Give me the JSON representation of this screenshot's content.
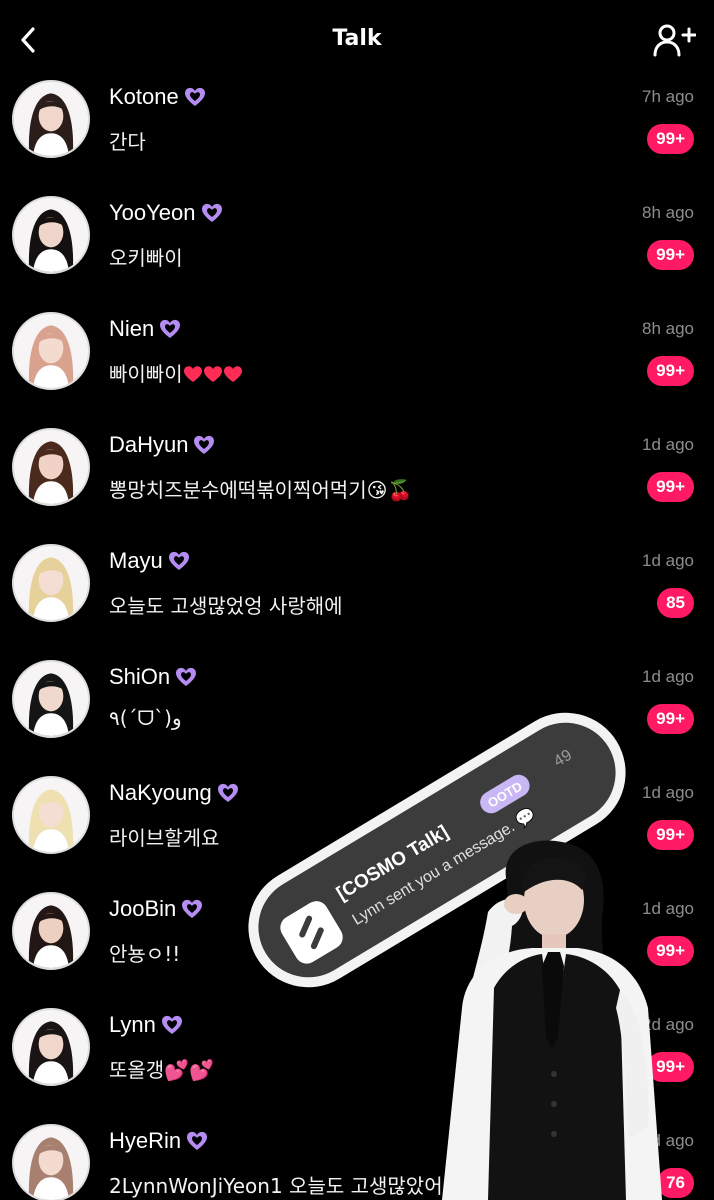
{
  "header": {
    "title": "Talk",
    "back_icon": "chevron-left-icon",
    "add_icon": "add-user-icon"
  },
  "colors": {
    "background": "#000000",
    "badge": "#ff1a63",
    "heart": "#b48cf2",
    "time": "#8d8d8d"
  },
  "chats": [
    {
      "name": "Kotone",
      "time": "7h ago",
      "message": "간다",
      "badge": "99+"
    },
    {
      "name": "YooYeon",
      "time": "8h ago",
      "message": "오키빠이",
      "badge": "99+"
    },
    {
      "name": "Nien",
      "time": "8h ago",
      "message": "빠이빠이",
      "badge": "99+",
      "emoji": "red-heart x3"
    },
    {
      "name": "DaHyun",
      "time": "1d ago",
      "message": "뽕망치즈분수에떡볶이찍어먹기😘🍒",
      "badge": "99+"
    },
    {
      "name": "Mayu",
      "time": "1d ago",
      "message": "오늘도 고생많었엉 사랑해에",
      "badge": "85"
    },
    {
      "name": "ShiOn",
      "time": "1d ago",
      "message": "٩(ˊᗜˋ)و",
      "badge": "99+"
    },
    {
      "name": "NaKyoung",
      "time": "1d ago",
      "message": "라이브할게요",
      "badge": "99+"
    },
    {
      "name": "JooBin",
      "time": "1d ago",
      "message": "안뇽ㅇ!!",
      "badge": "99+"
    },
    {
      "name": "Lynn",
      "time": "2d ago",
      "message": "또올갱💕💕",
      "badge": "99+"
    },
    {
      "name": "HyeRin",
      "time": "2d ago",
      "message": "2LynnWonJiYeon1 오늘도 고생많았어☺️☺️",
      "badge": "76"
    }
  ],
  "sticker": {
    "title": "[COSMO Talk]",
    "tag": "OOTD",
    "subtitle": "Lynn sent you a message. 💬",
    "time": "49"
  }
}
